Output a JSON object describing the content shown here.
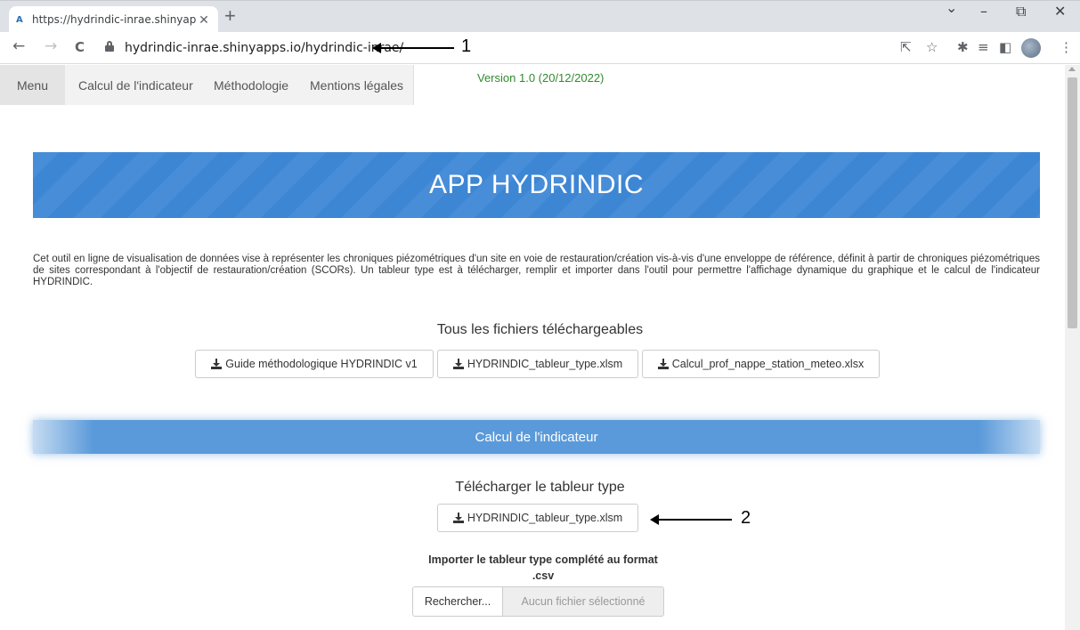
{
  "browser": {
    "tab_title": "https://hydrindic-inrae.shinyapps",
    "favicon_text": "A",
    "tab_close": "✕",
    "new_tab": "+",
    "url": "hydrindic-inrae.shinyapps.io/hydrindic-inrae/",
    "controls": {
      "dropdown": "⌄",
      "minimize": "–",
      "restore": "⧉",
      "close": "✕"
    },
    "nav": {
      "back": "←",
      "forward": "→",
      "reload": "C"
    }
  },
  "annotations": [
    {
      "number": "1"
    },
    {
      "number": "2"
    }
  ],
  "navbar": {
    "brand": "Menu",
    "links": [
      "Calcul de l'indicateur",
      "Méthodologie",
      "Mentions légales"
    ]
  },
  "version": "Version 1.0 (20/12/2022)",
  "banner_title": "APP HYDRINDIC",
  "intro": "Cet outil en ligne de visualisation de données vise à représenter les chroniques piézométriques d'un site en voie de restauration/création vis-à-vis d'une enveloppe de référence, définit à partir de chroniques piézométriques de sites correspondant à l'objectif de restauration/création (SCORs). Un tableur type est à télécharger, remplir et importer dans l'outil pour permettre l'affichage dynamique du graphique et le calcul de l'indicateur HYDRINDIC.",
  "files": {
    "heading": "Tous les fichiers téléchargeables",
    "buttons": [
      "Guide méthodologique HYDRINDIC v1",
      "HYDRINDIC_tableur_type.xlsm",
      "Calcul_prof_nappe_station_meteo.xlsx"
    ]
  },
  "section_title": "Calcul de l'indicateur",
  "template": {
    "heading": "Télécharger le tableur type",
    "button": "HYDRINDIC_tableur_type.xlsm"
  },
  "import": {
    "label_line1": "Importer le tableur type complété au format",
    "label_line2": ".csv",
    "browse": "Rechercher...",
    "placeholder": "Aucun fichier sélectionné"
  },
  "colors": {
    "banner": "#3d86d4",
    "section_bar": "#5b9ada",
    "version_text": "#2e8b2e"
  }
}
